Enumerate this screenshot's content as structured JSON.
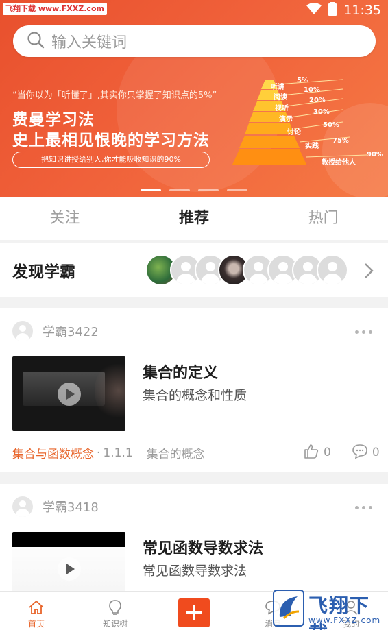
{
  "status_bar": {
    "watermark": "飞翔下载 www.FXXZ.com",
    "time": "11:35"
  },
  "search": {
    "placeholder": "输入关键词"
  },
  "banner": {
    "quote": "“当你以为「听懂了」,其实你只掌握了知识点的5%”",
    "headline_1": "费曼学习法",
    "headline_2": "史上最相见恨晚的学习方法",
    "pill": "把知识讲授给别人,你才能吸收知识的90%",
    "pyramid": [
      {
        "label": "听讲",
        "pct": "5%"
      },
      {
        "label": "阅读",
        "pct": "10%"
      },
      {
        "label": "视听",
        "pct": "20%"
      },
      {
        "label": "演示",
        "pct": "30%"
      },
      {
        "label": "讨论",
        "pct": "50%"
      },
      {
        "label": "实践",
        "pct": "75%"
      },
      {
        "label": "教授给他人",
        "pct": "90%"
      }
    ],
    "active_slide": 1,
    "slide_count": 4
  },
  "tabs": [
    {
      "label": "关注",
      "active": false
    },
    {
      "label": "推荐",
      "active": true
    },
    {
      "label": "热门",
      "active": false
    }
  ],
  "discover": {
    "title": "发现学霸"
  },
  "posts": [
    {
      "user": "学霸3422",
      "title": "集合的定义",
      "desc": "集合的概念和性质",
      "tag": "集合与函数概念",
      "dot": "·",
      "section": "1.1.1",
      "topic": "集合的概念",
      "likes": "0",
      "comments": "0"
    },
    {
      "user": "学霸3418",
      "title": "常见函数导数求法",
      "desc": "常见函数导数求法"
    }
  ],
  "bottom_nav": {
    "home": "首页",
    "knowledge_tree": "知识树",
    "messages": "消息",
    "mine": "我的"
  },
  "watermark_bottom": {
    "text": "飞翔下载",
    "url": "www.FXXZ.com"
  },
  "colors": {
    "accent": "#e8652b",
    "banner": "#f0613a",
    "add_button": "#f04b1e",
    "watermark": "#2c5fb0"
  }
}
